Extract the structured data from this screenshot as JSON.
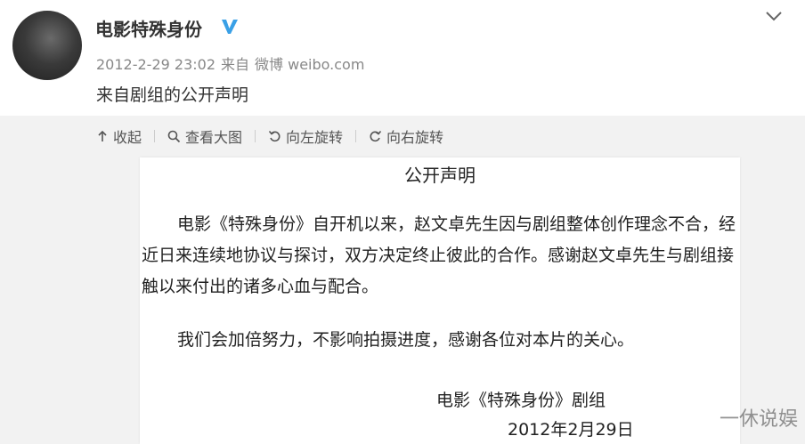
{
  "post": {
    "author": "电影特殊身份",
    "timestamp": "2012-2-29 23:02",
    "via_prefix": "来自",
    "source": "微博 weibo.com",
    "text": "来自剧组的公开声明",
    "avatar_caption": "",
    "verified_icon": "verified-v-icon",
    "menu_icon": "chevron-down-icon"
  },
  "toolbar": {
    "collapse": "收起",
    "view_large": "查看大图",
    "rotate_left": "向左旋转",
    "rotate_right": "向右旋转"
  },
  "statement": {
    "title": "公开声明",
    "paragraph1": "电影《特殊身份》自开机以来，赵文卓先生因与剧组整体创作理念不合，经近日来连续地协议与探讨，双方决定终止彼此的合作。感谢赵文卓先生与剧组接触以来付出的诸多心血与配合。",
    "paragraph2": "我们会加倍努力，不影响拍摄进度，感谢各位对本片的关心。",
    "signature_org": "电影《特殊身份》剧组",
    "signature_date": "2012年2月29日"
  },
  "watermark": "一休说娱",
  "colors": {
    "verified": "#3aa0e6",
    "background_media": "#f2f2f2",
    "meta_text": "#888888"
  }
}
